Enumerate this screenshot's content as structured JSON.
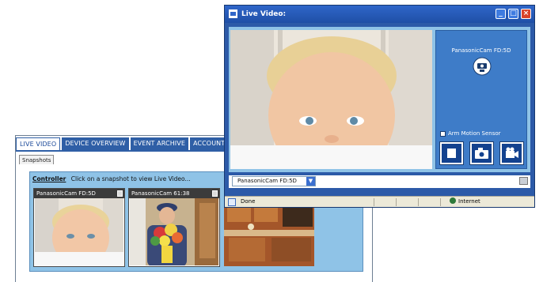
{
  "dashboard": {
    "tabs": [
      {
        "label": "LIVE VIDEO",
        "active": true
      },
      {
        "label": "DEVICE OVERVIEW",
        "active": false
      },
      {
        "label": "EVENT ARCHIVE",
        "active": false
      },
      {
        "label": "ACCOUNT",
        "active": false
      }
    ],
    "sub_tab": "Snapshots",
    "controller_label": "Controller",
    "instruction": "Click on a snapshot to view Live Video...",
    "snapshots": [
      {
        "title": "PanasonicCam FD:5D",
        "scene": "baby"
      },
      {
        "title": "PanasonicCam 61:38",
        "scene": "flowers-delivery"
      },
      {
        "title": "",
        "scene": "kitchen"
      }
    ]
  },
  "live_window": {
    "title": "Live Video:",
    "camera_name": "PanasonicCam FD:5D",
    "camera_icon": "pan-tilt-camera-icon",
    "arm_motion_label": "Arm Motion Sensor",
    "arm_motion_checked": false,
    "buttons": [
      "stop-icon",
      "snapshot-camera-icon",
      "video-record-icon"
    ],
    "selected_camera": "PanasonicCam FD:5D",
    "status_text": "Done",
    "zone_text": "Internet"
  },
  "colors": {
    "title_bar": "#2f66c9",
    "panel_blue": "#8fc3e7",
    "control_blue": "#3e7cc8",
    "tab_blue": "#2f5fa6"
  }
}
